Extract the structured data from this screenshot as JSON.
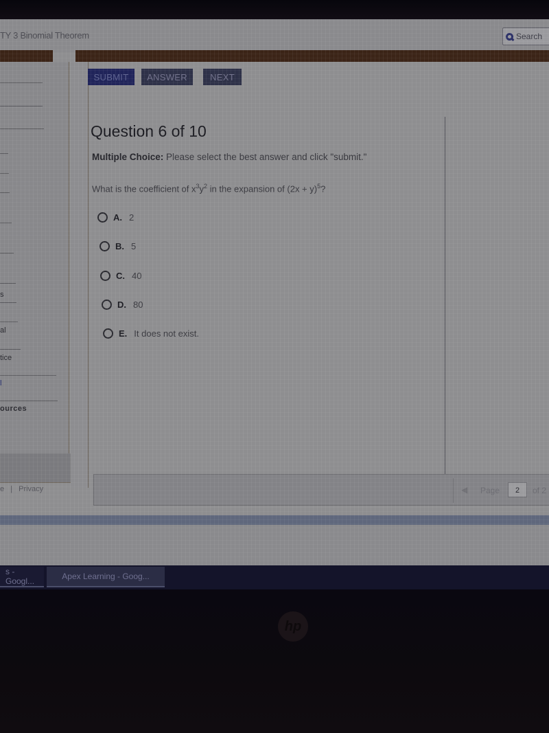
{
  "header": {
    "course_title": "TY 3   Binomial Theorem",
    "search_label": "Search"
  },
  "toolbar": {
    "submit_label": "SUBMIT",
    "answer_label": "ANSWER",
    "next_label": "NEXT"
  },
  "question": {
    "title": "Question 6 of 10",
    "instruction_bold": "Multiple Choice:",
    "instruction_text": " Please select the best answer and click \"submit.\"",
    "prompt_pre": "What is the coefficient of x",
    "prompt_exp1": "3",
    "prompt_mid1": "y",
    "prompt_exp2": "2",
    "prompt_mid2": " in the expansion of (2x + y)",
    "prompt_exp3": "5",
    "prompt_end": "?",
    "options": [
      {
        "letter": "A.",
        "text": "2"
      },
      {
        "letter": "B.",
        "text": "5"
      },
      {
        "letter": "C.",
        "text": "40"
      },
      {
        "letter": "D.",
        "text": "80"
      },
      {
        "letter": "E.",
        "text": "It does not exist."
      }
    ]
  },
  "sidebar": {
    "labels": [
      "s",
      "al",
      "tice",
      "l",
      "ources"
    ],
    "footer_left": "e",
    "footer_sep": "|",
    "footer_privacy": "Privacy"
  },
  "pager": {
    "label": "Page",
    "current": "2",
    "of_label": "of 2"
  },
  "taskbar": {
    "items": [
      {
        "label": "s - Googl..."
      },
      {
        "label": "Apex Learning - Goog..."
      }
    ]
  },
  "device": {
    "logo": "hp"
  }
}
